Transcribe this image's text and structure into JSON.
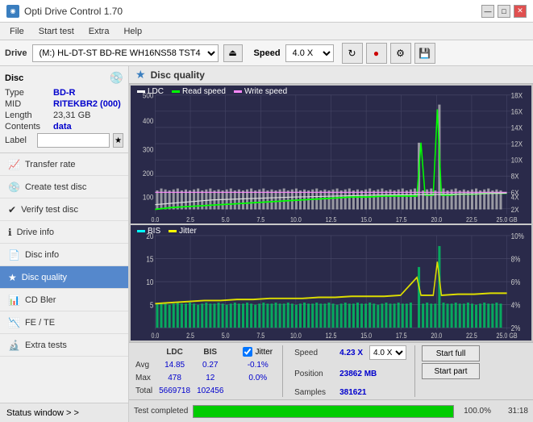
{
  "titlebar": {
    "title": "Opti Drive Control 1.70",
    "icon": "◉",
    "minimize": "—",
    "maximize": "□",
    "close": "✕"
  },
  "menubar": {
    "items": [
      "File",
      "Start test",
      "Extra",
      "Help"
    ]
  },
  "drivebar": {
    "label": "Drive",
    "drive_value": "(M:)  HL-DT-ST BD-RE  WH16NS58 TST4",
    "speed_label": "Speed",
    "speed_value": "4.0 X"
  },
  "disc": {
    "title": "Disc",
    "type_label": "Type",
    "type_value": "BD-R",
    "mid_label": "MID",
    "mid_value": "RITEKBR2 (000)",
    "length_label": "Length",
    "length_value": "23,31 GB",
    "contents_label": "Contents",
    "contents_value": "data",
    "label_label": "Label"
  },
  "nav": {
    "items": [
      {
        "id": "transfer-rate",
        "label": "Transfer rate",
        "icon": "📈"
      },
      {
        "id": "create-test-disc",
        "label": "Create test disc",
        "icon": "💿"
      },
      {
        "id": "verify-test-disc",
        "label": "Verify test disc",
        "icon": "✔"
      },
      {
        "id": "drive-info",
        "label": "Drive info",
        "icon": "ℹ"
      },
      {
        "id": "disc-info",
        "label": "Disc info",
        "icon": "📄"
      },
      {
        "id": "disc-quality",
        "label": "Disc quality",
        "icon": "★",
        "active": true
      },
      {
        "id": "cd-bler",
        "label": "CD Bler",
        "icon": "📊"
      },
      {
        "id": "fe-te",
        "label": "FE / TE",
        "icon": "📉"
      },
      {
        "id": "extra-tests",
        "label": "Extra tests",
        "icon": "🔬"
      }
    ],
    "status_window": "Status window > >"
  },
  "disc_quality": {
    "title": "Disc quality",
    "chart1": {
      "legend": [
        {
          "label": "LDC",
          "color": "#ffffff"
        },
        {
          "label": "Read speed",
          "color": "#00ff00"
        },
        {
          "label": "Write speed",
          "color": "#ff88ff"
        }
      ],
      "y_max": 500,
      "x_max": 25,
      "y_right_labels": [
        "18X",
        "16X",
        "14X",
        "12X",
        "10X",
        "8X",
        "6X",
        "4X",
        "2X"
      ],
      "x_labels": [
        "0.0",
        "2.5",
        "5.0",
        "7.5",
        "10.0",
        "12.5",
        "15.0",
        "17.5",
        "20.0",
        "22.5",
        "25.0 GB"
      ]
    },
    "chart2": {
      "legend": [
        {
          "label": "BIS",
          "color": "#00ffff"
        },
        {
          "label": "Jitter",
          "color": "#ffff00"
        }
      ],
      "y_max": 20,
      "x_max": 25,
      "y_right_labels": [
        "10%",
        "8%",
        "6%",
        "4%",
        "2%"
      ],
      "x_labels": [
        "0.0",
        "2.5",
        "5.0",
        "7.5",
        "10.0",
        "12.5",
        "15.0",
        "17.5",
        "20.0",
        "22.5",
        "25.0 GB"
      ]
    }
  },
  "stats": {
    "columns": [
      "LDC",
      "BIS"
    ],
    "jitter_label": "Jitter",
    "jitter_checked": true,
    "rows": [
      {
        "label": "Avg",
        "ldc": "14.85",
        "bis": "0.27",
        "jitter": "-0.1%"
      },
      {
        "label": "Max",
        "ldc": "478",
        "bis": "12",
        "jitter": "0.0%"
      },
      {
        "label": "Total",
        "ldc": "5669718",
        "bis": "102456",
        "jitter": ""
      }
    ],
    "speed_label": "Speed",
    "speed_value": "4.23 X",
    "speed_dropdown": "4.0 X",
    "position_label": "Position",
    "position_value": "23862 MB",
    "samples_label": "Samples",
    "samples_value": "381621",
    "start_full": "Start full",
    "start_part": "Start part"
  },
  "progress": {
    "status": "Test completed",
    "percent": 100,
    "percent_text": "100.0%",
    "time": "31:18"
  }
}
